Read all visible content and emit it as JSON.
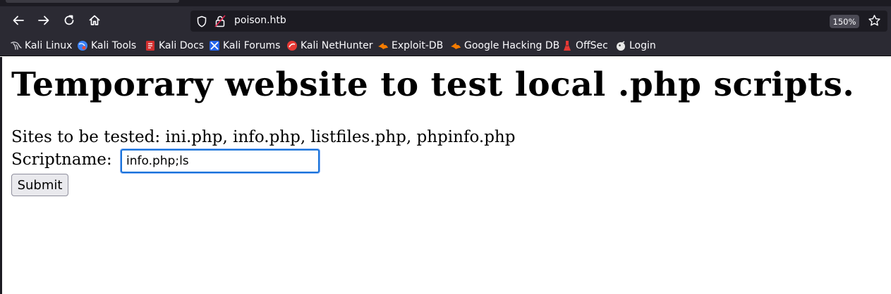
{
  "browser": {
    "url": "poison.htb",
    "zoom": "150%",
    "icons": {
      "back": "arrow-left-icon",
      "forward": "arrow-right-icon",
      "reload": "reload-icon",
      "home": "home-icon",
      "tracking": "shield-icon",
      "security": "lock-icon",
      "bookmark": "star-icon"
    }
  },
  "bookmarks": [
    {
      "label": "Kali Linux",
      "icon": "kali-dragon-icon"
    },
    {
      "label": "Kali Tools",
      "icon": "kali-tools-icon"
    },
    {
      "label": "Kali Docs",
      "icon": "kali-docs-icon"
    },
    {
      "label": "Kali Forums",
      "icon": "kali-forums-icon"
    },
    {
      "label": "Kali NetHunter",
      "icon": "nethunter-icon"
    },
    {
      "label": "Exploit-DB",
      "icon": "exploit-db-icon"
    },
    {
      "label": "Google Hacking DB",
      "icon": "ghdb-icon"
    },
    {
      "label": "OffSec",
      "icon": "offsec-icon"
    },
    {
      "label": "Login",
      "icon": "login-icon"
    }
  ],
  "page": {
    "title": "Temporary website to test local .php scripts.",
    "sites_text": "Sites to be tested: ini.php, info.php, listfiles.php, phpinfo.php",
    "script_label": "Scriptname:",
    "script_value": "info.php;ls",
    "submit_label": "Submit"
  },
  "colors": {
    "chrome_background": "#2b2a33",
    "url_field": "#1c1b22",
    "focus_ring": "#1a73d9"
  }
}
